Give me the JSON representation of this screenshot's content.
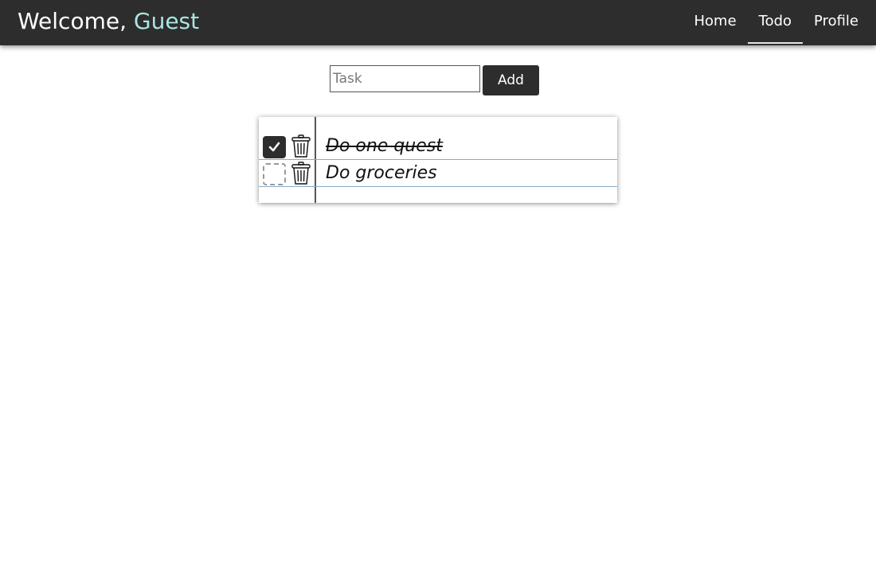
{
  "header": {
    "welcome_prefix": "Welcome,",
    "username": "Guest",
    "nav": [
      {
        "label": "Home",
        "active": false
      },
      {
        "label": "Todo",
        "active": true
      },
      {
        "label": "Profile",
        "active": false
      }
    ]
  },
  "form": {
    "placeholder": "Task",
    "value": "",
    "add_label": "Add"
  },
  "todos": [
    {
      "text": "Do one quest",
      "done": true
    },
    {
      "text": "Do groceries",
      "done": false
    }
  ],
  "colors": {
    "navbar": "#2d2d2d",
    "username_accent": "#a8e6e3",
    "button": "#2d2d2d",
    "rule_line": "#8aaac4"
  },
  "icons": {
    "check": "check-icon",
    "trash": "trash-icon"
  }
}
